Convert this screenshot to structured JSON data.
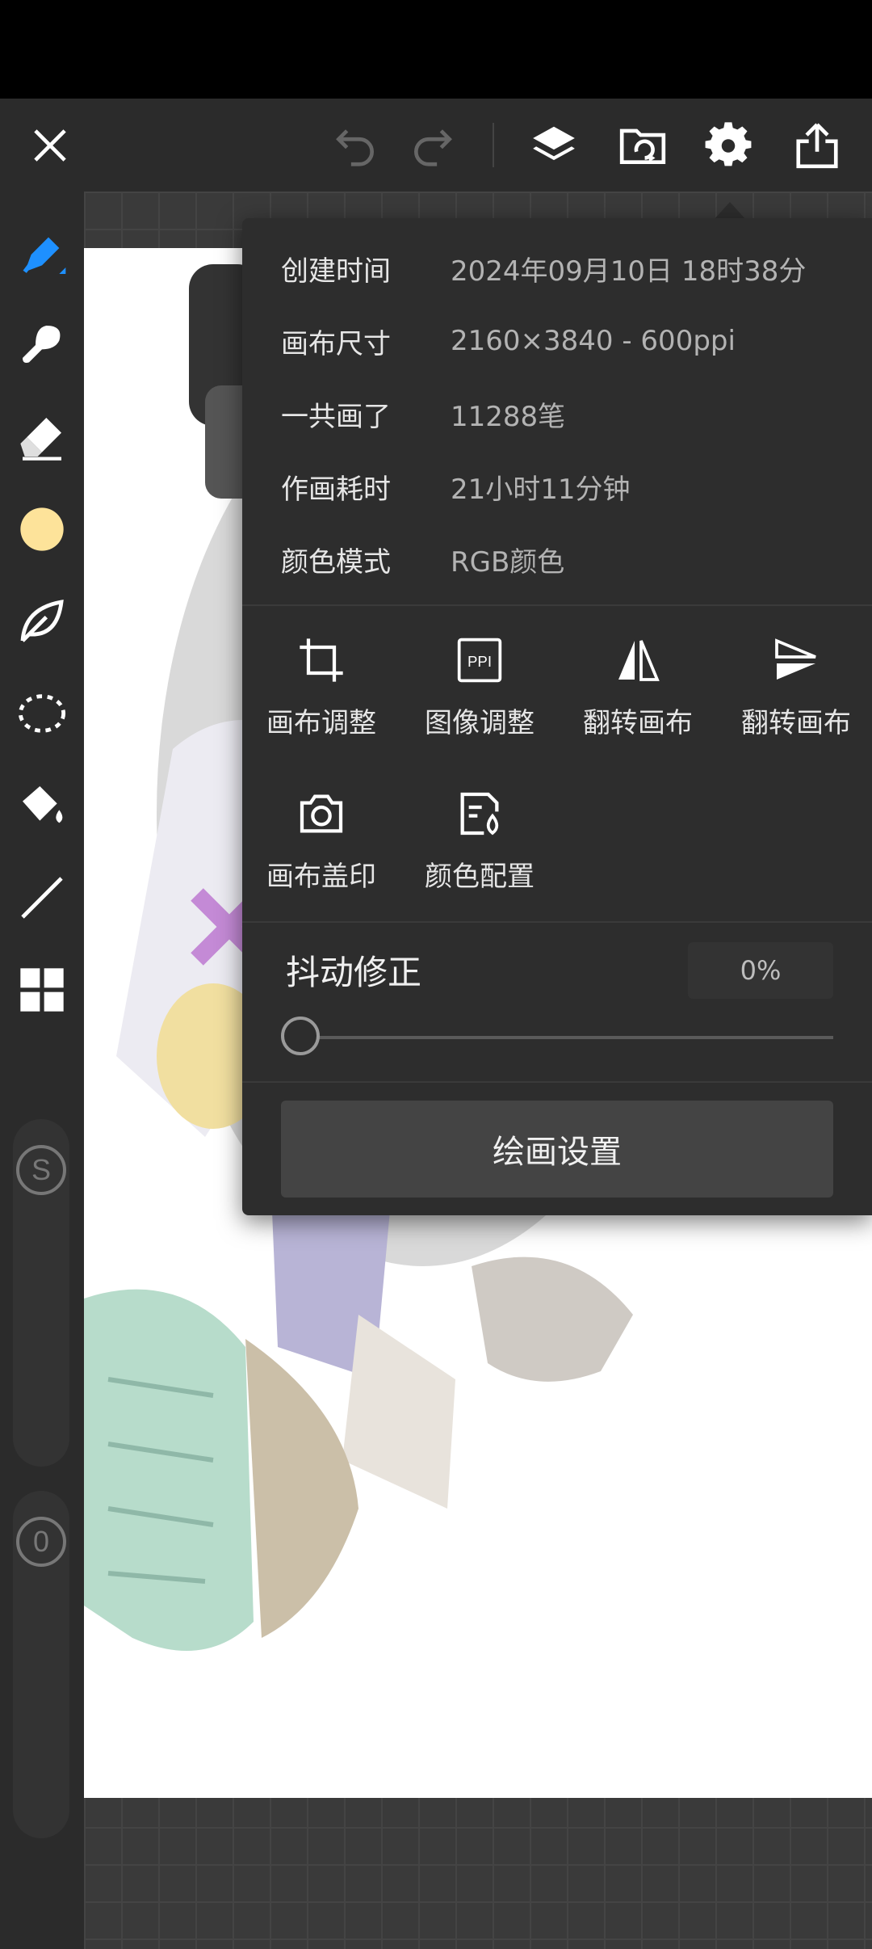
{
  "toolbar": {
    "close": "close-icon",
    "undo": "undo-icon",
    "redo": "redo-icon",
    "layers": "layers-icon",
    "import": "folder-icon",
    "settings": "gear-icon",
    "share": "share-icon"
  },
  "sidebar": {
    "tools": [
      "pen-icon",
      "brush-icon",
      "eraser-icon",
      "color-swatch",
      "leaf-icon",
      "lasso-icon",
      "fill-bucket-icon",
      "line-icon",
      "grid-icon"
    ],
    "active_color": "#fde39a",
    "accent": "#1e90ff",
    "size_badge": "S",
    "opacity_badge": "0"
  },
  "panel": {
    "info": [
      {
        "label": "创建时间",
        "value": "2024年09月10日 18时38分"
      },
      {
        "label": "画布尺寸",
        "value": "2160×3840 - 600ppi"
      },
      {
        "label": "一共画了",
        "value": "11288笔"
      },
      {
        "label": "作画耗时",
        "value": "21小时11分钟"
      },
      {
        "label": "颜色模式",
        "value": "RGB颜色"
      }
    ],
    "actions": [
      {
        "label": "画布调整",
        "icon": "crop-icon"
      },
      {
        "label": "图像调整",
        "icon": "ppi-icon",
        "icon_text": "PPI"
      },
      {
        "label": "翻转画布",
        "icon": "flip-horizontal-icon"
      },
      {
        "label": "翻转画布",
        "icon": "flip-vertical-icon"
      },
      {
        "label": "画布盖印",
        "icon": "camera-icon"
      },
      {
        "label": "颜色配置",
        "icon": "color-profile-icon"
      }
    ],
    "stabilizer": {
      "label": "抖动修正",
      "value": "0%",
      "level": 0
    },
    "settings_button": "绘画设置"
  }
}
